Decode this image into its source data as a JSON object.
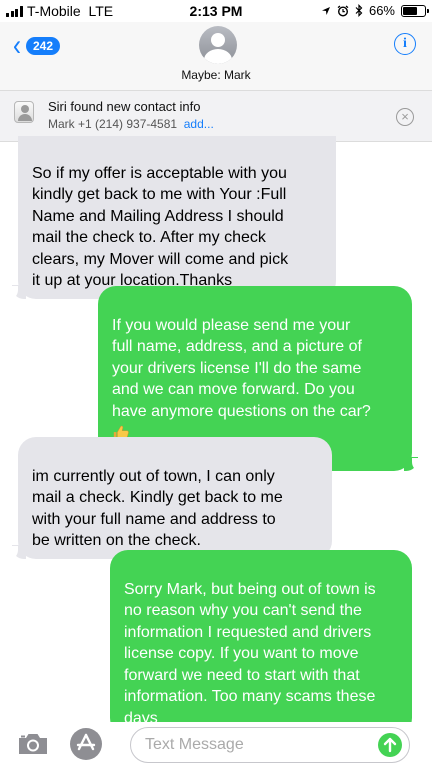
{
  "status_bar": {
    "carrier": "T-Mobile",
    "network": "LTE",
    "time": "2:13 PM",
    "battery_percent": "66%",
    "battery_level": 0.66,
    "icons": [
      "location-arrow-icon",
      "alarm-icon",
      "bluetooth-icon"
    ]
  },
  "header": {
    "back_count": "242",
    "contact_name": "Maybe: Mark",
    "info_label": "i"
  },
  "siri_banner": {
    "title": "Siri found new contact info",
    "subtitle": "Mark +1 (214) 937-4581",
    "add_label": "add...",
    "close_label": "×"
  },
  "messages": [
    {
      "direction": "received",
      "text": "So if my offer is acceptable with you\nkindly get back to me with Your :Full\nName and Mailing Address I should\nmail the check to. After my check\nclears, my Mover will come and pick\nit up at your location.Thanks"
    },
    {
      "direction": "sent",
      "text": "If you would please send me your\nfull name, address, and a picture of\nyour drivers license I'll do the same\nand we can move forward. Do you\nhave anymore questions on the car?",
      "emoji": "thumbs-up-icon"
    },
    {
      "direction": "received",
      "text": "im currently out of town, I can only\nmail a check. Kindly get back to me\nwith your full name and address to\nbe written on the check."
    },
    {
      "direction": "sent",
      "text": "Sorry Mark, but being out of town is\nno reason why you can't send the\ninformation I requested and drivers\nlicense copy. If you want to move\nforward we need to start with that\ninformation. Too many scams these\ndays"
    }
  ],
  "input_bar": {
    "placeholder": "Text Message",
    "value": ""
  },
  "colors": {
    "ios_blue": "#157efb",
    "sent_bubble": "#44d354",
    "received_bubble": "#e5e5ea"
  }
}
